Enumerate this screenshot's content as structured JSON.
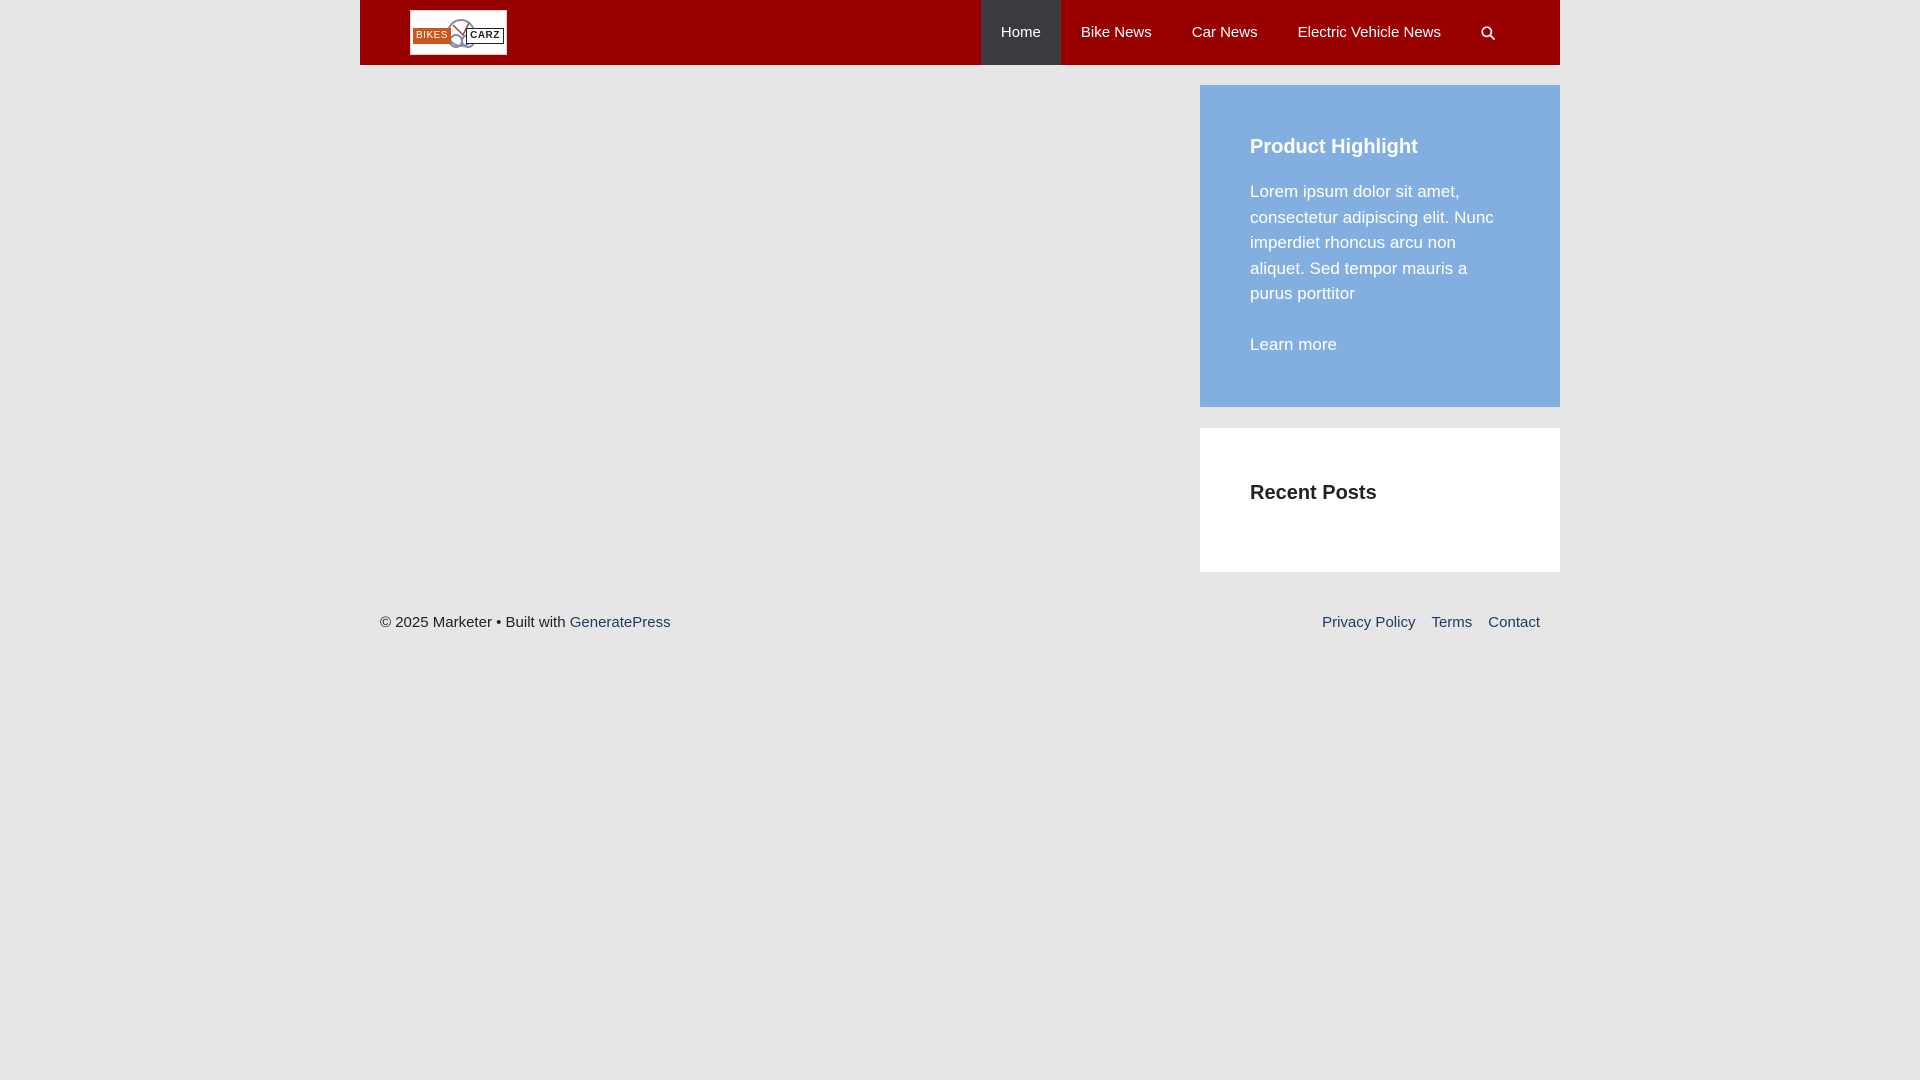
{
  "header": {
    "logo": {
      "left_text": "BIKES",
      "right_text": "CARZ"
    },
    "nav": {
      "items": [
        {
          "label": "Home",
          "active": true
        },
        {
          "label": "Bike News",
          "active": false
        },
        {
          "label": "Car News",
          "active": false
        },
        {
          "label": "Electric Vehicle News",
          "active": false
        }
      ],
      "search_icon": "search-icon"
    }
  },
  "sidebar": {
    "highlight": {
      "title": "Product Highlight",
      "text": "Lorem ipsum dolor sit amet, consectetur adipiscing elit. Nunc imperdiet rhoncus arcu non aliquet. Sed tempor mauris a purus porttitor",
      "link": "Learn more"
    },
    "recent": {
      "title": "Recent Posts"
    }
  },
  "footer": {
    "copyright": "© 2025 Marketer • Built with",
    "credit_link": "GeneratePress",
    "links": [
      "Privacy Policy",
      "Terms",
      "Contact"
    ]
  },
  "colors": {
    "header_bg": "#990000",
    "active_nav_bg": "#3b3b3f",
    "highlight_bg": "#82afe0",
    "page_bg": "#e6e6e6"
  }
}
